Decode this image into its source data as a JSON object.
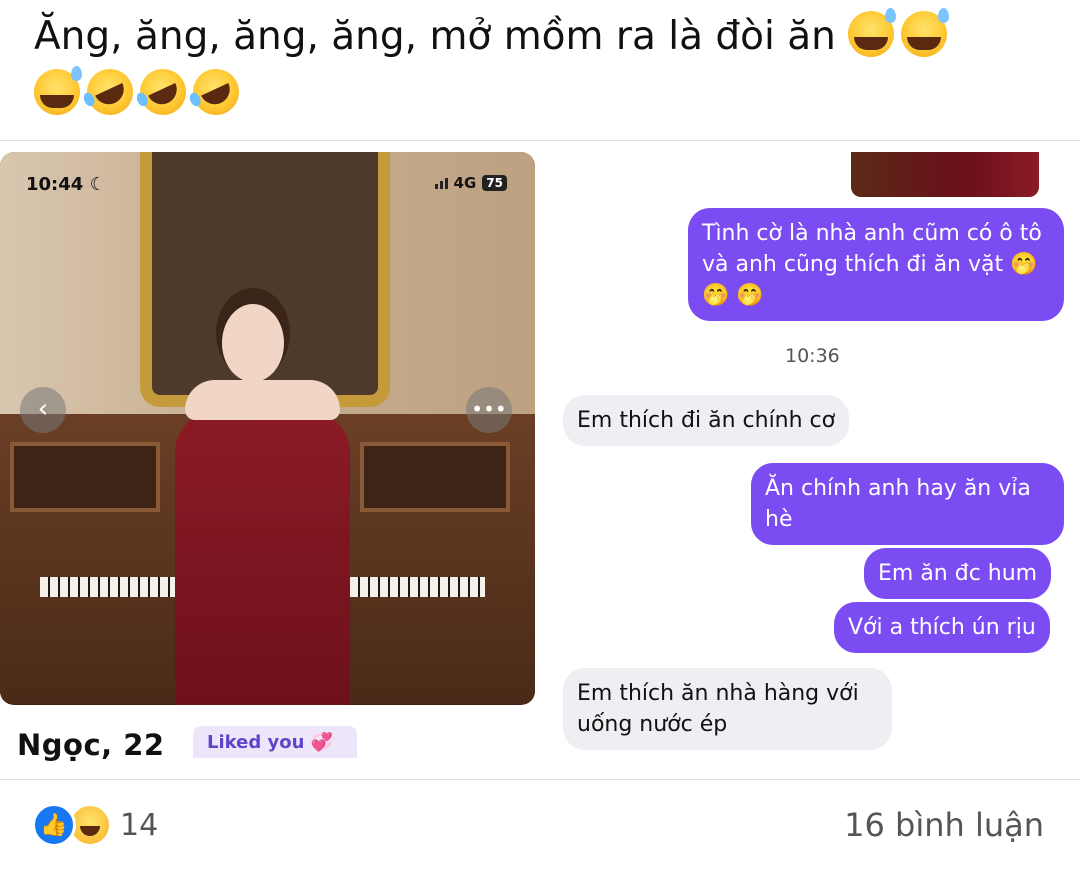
{
  "post": {
    "text": "Ăng, ăng, ăng, ăng, mở mồm ra là đòi ăn",
    "emojis_line1": [
      "sweat-smile-emoji",
      "sweat-smile-emoji"
    ],
    "emojis_line2": [
      "sweat-smile-emoji",
      "rofl-emoji",
      "rofl-emoji",
      "rofl-emoji"
    ]
  },
  "dating_profile": {
    "status_time": "10:44",
    "network": "4G",
    "battery": "75",
    "name": "Ngọc, 22",
    "liked_label": "Liked you"
  },
  "chat": {
    "messages": [
      {
        "side": "out",
        "text": "Tình cờ là nhà anh cũm có ô tô và anh cũng thích đi ăn vặt 🤭 🤭 🤭"
      },
      {
        "side": "time",
        "text": "10:36"
      },
      {
        "side": "in",
        "text": "Em thích đi ăn chính cơ"
      },
      {
        "side": "out",
        "text": "Ăn chính anh hay ăn vỉa hè"
      },
      {
        "side": "out",
        "text": "Em ăn đc hum"
      },
      {
        "side": "out",
        "text": "Với a thích ún rịu"
      },
      {
        "side": "in",
        "text": "Em thích ăn nhà hàng với uống nước ép"
      }
    ]
  },
  "footer": {
    "reaction_count": "14",
    "reactions": [
      "like-icon",
      "haha-icon"
    ],
    "comments_label": "16 bình luận"
  },
  "colors": {
    "outgoing_bubble": "#7a4cf2",
    "incoming_bubble": "#eeeff2",
    "like_blue": "#1877f2"
  }
}
